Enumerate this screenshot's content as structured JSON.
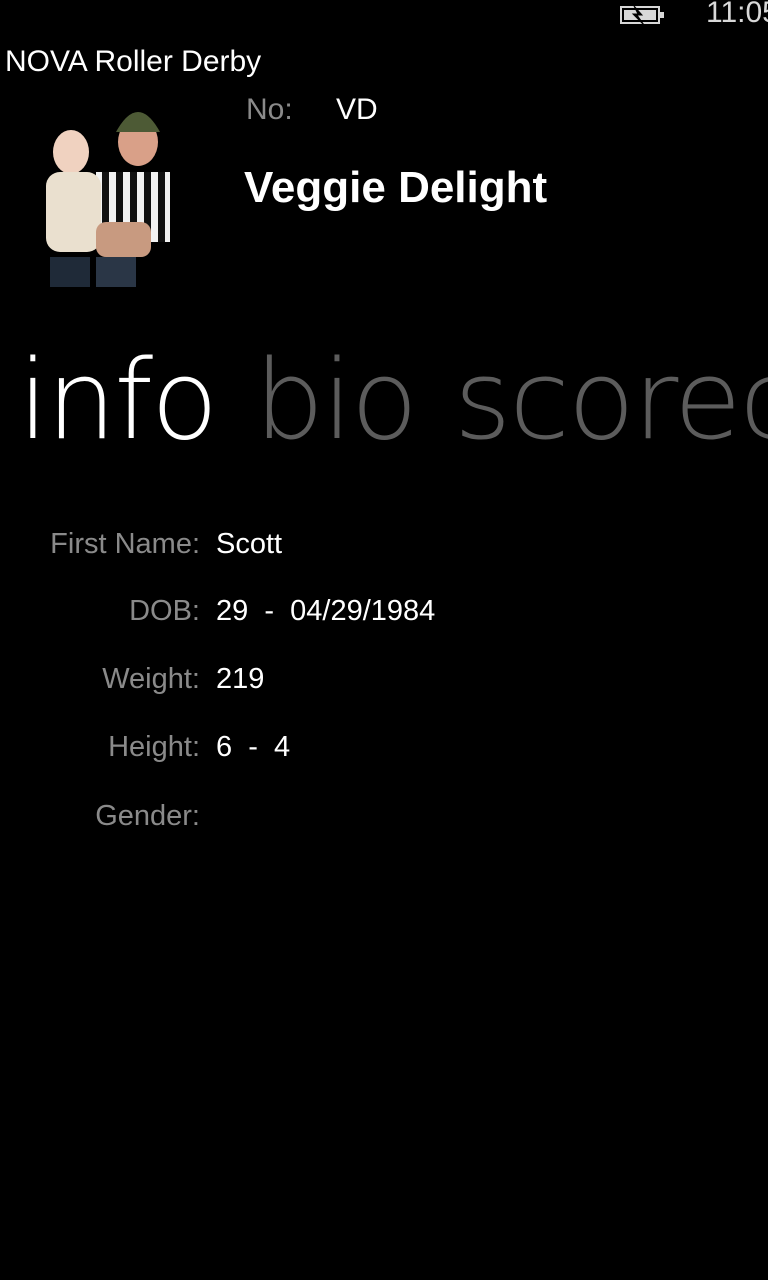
{
  "status_bar": {
    "time": "11:05",
    "battery_icon": "battery-charging-icon"
  },
  "app": {
    "title": "NOVA Roller Derby"
  },
  "player": {
    "number_label": "No:",
    "number": "VD",
    "name": "Veggie Delight",
    "photo": "player-photo"
  },
  "pivot": {
    "tabs": [
      {
        "label": "info",
        "active": true
      },
      {
        "label": "bio",
        "active": false
      },
      {
        "label": "scorecard",
        "active": false
      }
    ]
  },
  "info": {
    "rows": [
      {
        "label": "First Name:",
        "value": "Scott"
      },
      {
        "label": "DOB:",
        "value": "29  -  04/29/1984"
      },
      {
        "label": "Weight:",
        "value": "219"
      },
      {
        "label": "Height:",
        "value": "6  -  4"
      },
      {
        "label": "Gender:",
        "value": ""
      }
    ]
  },
  "colors": {
    "background": "#000000",
    "text": "#ffffff",
    "muted": "#8a8a8a",
    "inactive_tab": "#5c5c5c"
  }
}
